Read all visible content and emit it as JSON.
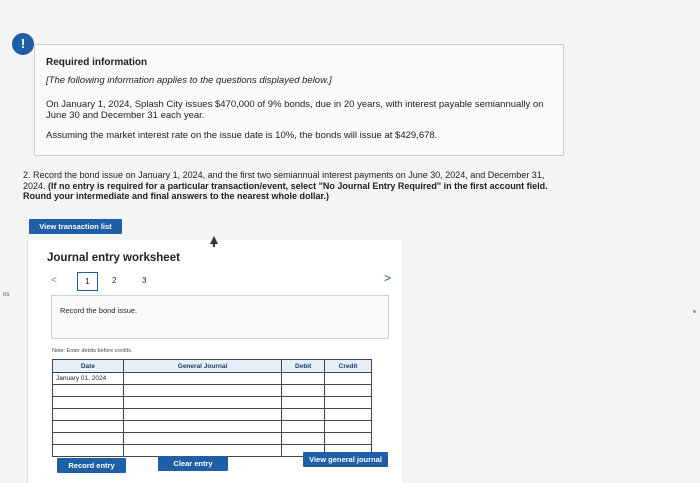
{
  "badge": "!",
  "info": {
    "title": "Required information",
    "note": "[The following information applies to the questions displayed below.]",
    "para1": "On January 1, 2024, Splash City issues $470,000 of 9% bonds, due in 20 years, with interest payable semiannually on June 30 and December 31 each year.",
    "para2": "Assuming the market interest rate on the issue date is 10%, the bonds will issue at $429,678."
  },
  "question": {
    "text": "2. Record the bond issue on January 1, 2024, and the first two semiannual interest payments on June 30, 2024, and December 31, 2024.",
    "instruction": "(If no entry is required for a particular transaction/event, select \"No Journal Entry Required\" in the first account field. Round your intermediate and final answers to the nearest whole dollar.)"
  },
  "buttons": {
    "view_transaction_list": "View transaction list",
    "record_entry": "Record entry",
    "clear_entry": "Clear entry",
    "view_general_journal": "View general journal"
  },
  "worksheet": {
    "title": "Journal entry worksheet",
    "prev": "<",
    "next": ">",
    "pages": [
      "1",
      "2",
      "3"
    ],
    "record_text": "Record the bond issue.",
    "note": "Note: Enter debits before credits."
  },
  "table": {
    "headers": {
      "date": "Date",
      "general_journal": "General Journal",
      "debit": "Debit",
      "credit": "Credit"
    },
    "first_date": "January 01, 2024"
  },
  "edge_mark": "ns"
}
